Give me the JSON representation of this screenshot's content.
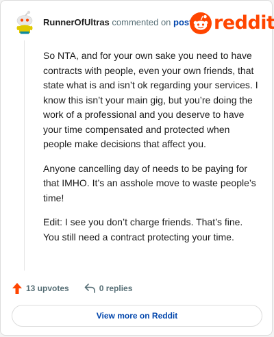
{
  "comment": {
    "author": "RunnerOfUltras",
    "action_text": "commented on",
    "post_link": "post",
    "paragraphs": [
      "So NTA, and for your own sake you need to have contracts with people, even your own friends, that state what is and isn’t ok regarding your services. I know this isn’t your main gig, but you’re doing the work of a professional and you deserve to have your time compensated and protected when people make decisions that affect you.",
      "Anyone cancelling day of needs to be paying for that IMHO. It’s an asshole move to waste people’s time!",
      "Edit: I see you don’t charge friends. That’s fine. You still need a contract protecting your time."
    ]
  },
  "brand": {
    "logo_text": "reddit",
    "accent": "#ff4500"
  },
  "footer": {
    "upvotes_label": "13 upvotes",
    "replies_label": "0 replies",
    "view_more_label": "View more on Reddit"
  },
  "icons": {
    "upvote": "upvote-arrow-icon",
    "reply": "reply-arrow-icon",
    "logo": "snoo-logo-icon",
    "avatar": "snoo-avatar-icon"
  },
  "colors": {
    "link": "#0045ac",
    "muted": "#576f76",
    "text": "#1c1c1c",
    "upvote": "#ff4500"
  }
}
